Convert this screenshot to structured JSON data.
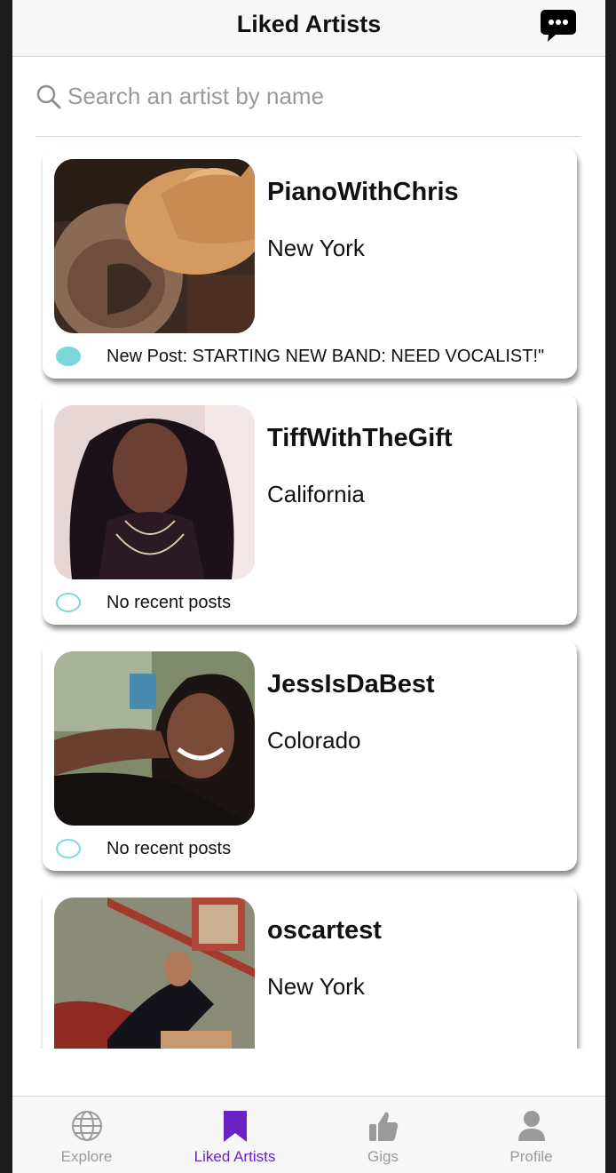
{
  "header": {
    "title": "Liked Artists"
  },
  "search": {
    "placeholder": "Search an artist by name",
    "value": ""
  },
  "artists": [
    {
      "name": "PianoWithChris",
      "location": "New York",
      "post": "New Post: STARTING NEW BAND: NEED VOCALIST!\"",
      "has_new_post": true
    },
    {
      "name": "TiffWithTheGift",
      "location": "California",
      "post": "No recent posts",
      "has_new_post": false
    },
    {
      "name": "JessIsDaBest",
      "location": "Colorado",
      "post": "No recent posts",
      "has_new_post": false
    },
    {
      "name": "oscartest",
      "location": "New York",
      "post": "",
      "has_new_post": false
    }
  ],
  "tabs": [
    {
      "label": "Explore",
      "icon": "globe-icon",
      "active": false
    },
    {
      "label": "Liked Artists",
      "icon": "bookmark-icon",
      "active": true
    },
    {
      "label": "Gigs",
      "icon": "thumbs-up-icon",
      "active": false
    },
    {
      "label": "Profile",
      "icon": "person-icon",
      "active": false
    }
  ],
  "colors": {
    "accent": "#6a22c4",
    "indicator": "#7ad8dc",
    "inactive_tab": "#9a9a9a"
  }
}
